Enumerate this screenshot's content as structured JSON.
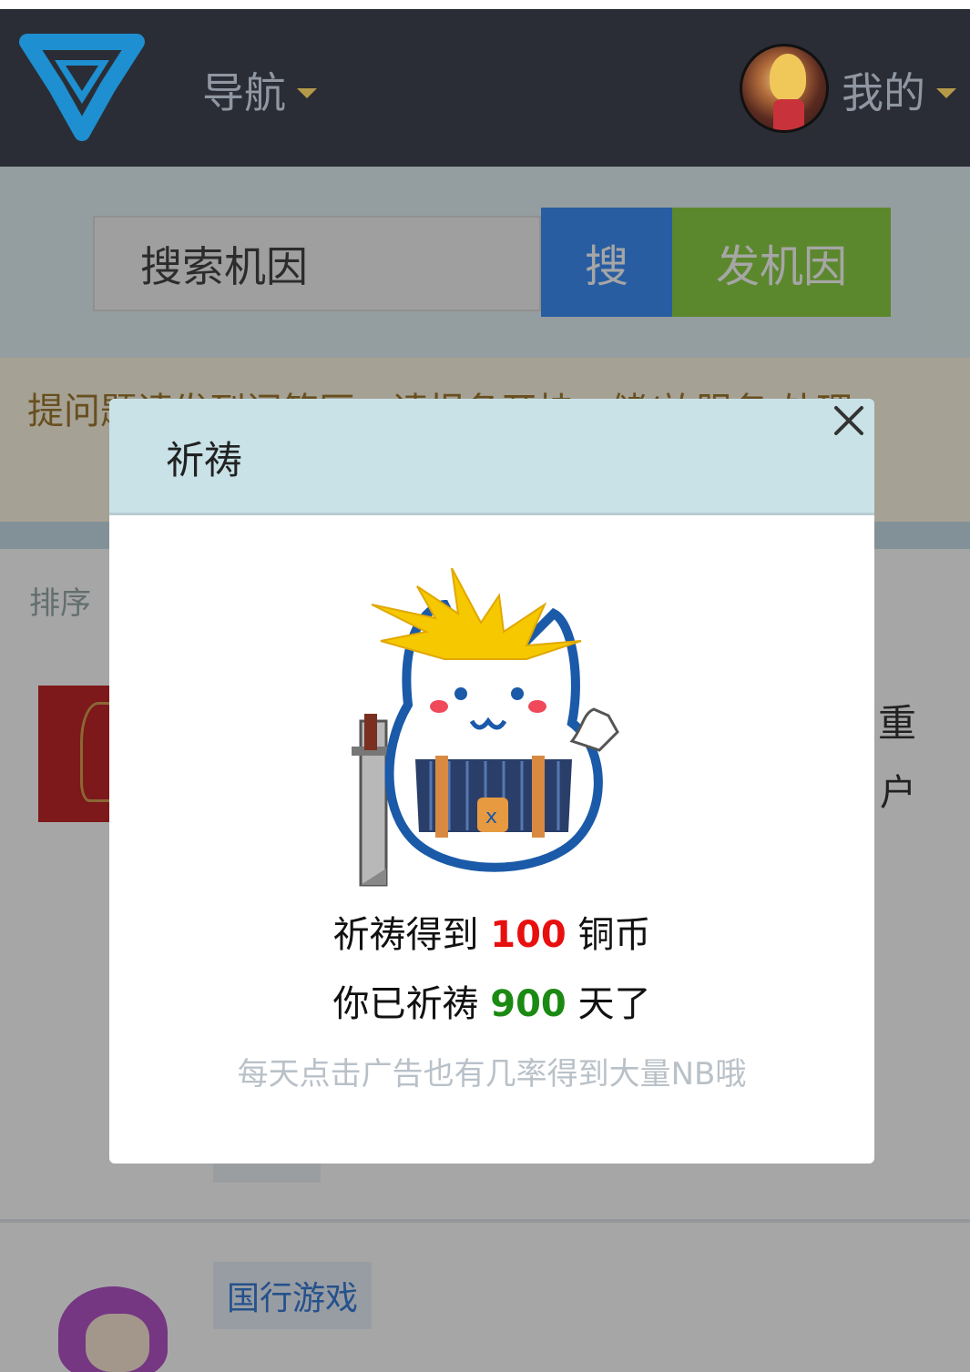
{
  "navbar": {
    "guide_label": "导航",
    "mine_label": "我的"
  },
  "search": {
    "placeholder": "搜索机因",
    "search_button": "搜",
    "post_button": "发机因"
  },
  "notice": {
    "text": "提问题请发到问答区，请报备开挂、储/放服务 处理。"
  },
  "list": {
    "sort_label": "排序",
    "item1_side_line1": "重",
    "item1_side_line2": "户",
    "item2_tag": "国行游戏"
  },
  "modal": {
    "title": "祈祷",
    "line1_prefix": "祈祷得到",
    "coins": "100",
    "line1_suffix": "铜币",
    "line2_prefix": "你已祈祷",
    "days": "900",
    "line2_suffix": "天了",
    "hint": "每天点击广告也有几率得到大量NB哦"
  },
  "colors": {
    "navbar_bg": "#2a2d35",
    "search_button": "#3f8ff8",
    "post_button": "#8ed246",
    "coins_red": "#e80f0f",
    "days_green": "#1a8a12",
    "modal_header": "#c9e2e7"
  },
  "icons": {
    "logo": "site-logo-icon",
    "caret": "caret-down-icon",
    "close": "close-icon",
    "mascot": "mascot-cat-illustration"
  }
}
